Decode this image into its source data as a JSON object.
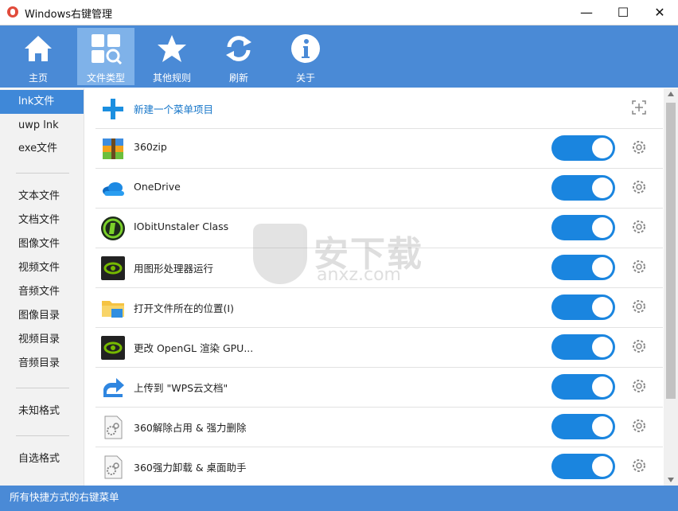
{
  "window": {
    "title": "Windows右键管理",
    "minimize": "—",
    "maximize": "☐",
    "close": "✕"
  },
  "toolbar": {
    "items": [
      {
        "label": "主页",
        "icon": "home-icon"
      },
      {
        "label": "文件类型",
        "icon": "file-type-icon"
      },
      {
        "label": "其他规则",
        "icon": "star-icon"
      },
      {
        "label": "刷新",
        "icon": "refresh-icon"
      },
      {
        "label": "关于",
        "icon": "info-icon"
      }
    ],
    "active": "文件类型"
  },
  "sidebar": {
    "items": [
      {
        "label": "lnk文件"
      },
      {
        "label": "uwp lnk"
      },
      {
        "label": "exe文件"
      },
      {
        "label": "文本文件"
      },
      {
        "label": "文档文件"
      },
      {
        "label": "图像文件"
      },
      {
        "label": "视频文件"
      },
      {
        "label": "音频文件"
      },
      {
        "label": "图像目录"
      },
      {
        "label": "视频目录"
      },
      {
        "label": "音频目录"
      },
      {
        "label": "未知格式"
      },
      {
        "label": "自选格式"
      }
    ],
    "active": "lnk文件"
  },
  "new_item": {
    "label": "新建一个菜单项目"
  },
  "rows": [
    {
      "name": "360zip",
      "icon": "archive-icon",
      "enabled": true
    },
    {
      "name": "OneDrive",
      "icon": "cloud-icon",
      "enabled": true
    },
    {
      "name": "IObitUnstaler Class",
      "icon": "iobit-uninstaller-icon",
      "enabled": true
    },
    {
      "name": "用图形处理器运行",
      "icon": "nvidia-icon",
      "enabled": true
    },
    {
      "name": "打开文件所在的位置(I)",
      "icon": "folder-icon",
      "enabled": true
    },
    {
      "name": "更改 OpenGL 渲染 GPU...",
      "icon": "nvidia-icon",
      "enabled": true
    },
    {
      "name": "上传到 \"WPS云文档\"",
      "icon": "share-arrow-icon",
      "enabled": true
    },
    {
      "name": "360解除占用 & 强力删除",
      "icon": "settings-file-icon",
      "enabled": true
    },
    {
      "name": "360强力卸载 & 桌面助手",
      "icon": "settings-file-icon",
      "enabled": true
    }
  ],
  "status": {
    "text": "所有快捷方式的右键菜单"
  },
  "watermark": {
    "text": "安下载",
    "sub": "anxz.com"
  },
  "colors": {
    "accent": "#4a8ad6",
    "toggle_on": "#1a85df",
    "sidebar_active": "#3f88d8"
  }
}
